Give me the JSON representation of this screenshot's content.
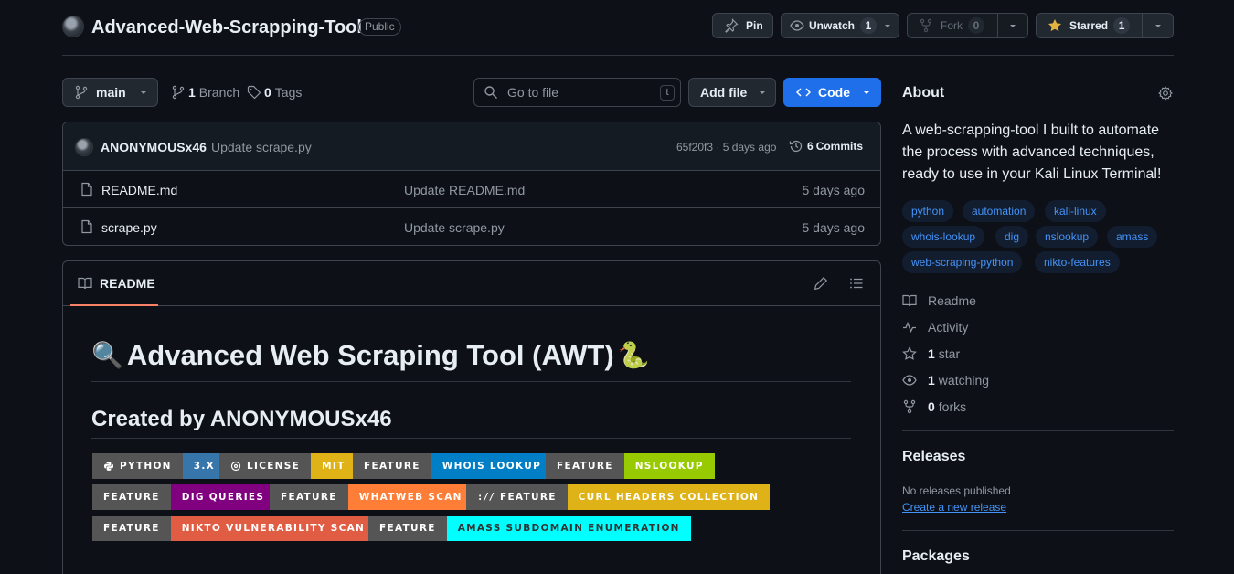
{
  "header": {
    "repo_name": "Advanced-Web-Scrapping-Tool",
    "visibility": "Public",
    "pin_label": "Pin",
    "unwatch_label": "Unwatch",
    "unwatch_count": "1",
    "fork_label": "Fork",
    "fork_count": "0",
    "starred_label": "Starred",
    "starred_count": "1"
  },
  "toolbar": {
    "branch": "main",
    "branches_count": "1",
    "branches_label": "Branch",
    "tags_count": "0",
    "tags_label": "Tags",
    "goto_placeholder": "Go to file",
    "goto_kbd": "t",
    "add_file": "Add file",
    "code": "Code"
  },
  "latest_commit": {
    "author": "ANONYMOUSx46",
    "message": "Update scrape.py",
    "hash_time": "65f20f3 · 5 days ago",
    "commits_count": "6",
    "commits_label": "Commits"
  },
  "files": [
    {
      "name": "README.md",
      "message": "Update README.md",
      "time": "5 days ago"
    },
    {
      "name": "scrape.py",
      "message": "Update scrape.py",
      "time": "5 days ago"
    }
  ],
  "readme": {
    "tab": "README",
    "h1_emoji_left": "🔍",
    "h1": "Advanced Web Scraping Tool (AWT)",
    "h1_emoji_right": "🐍",
    "h2": "Created by ANONYMOUSx46",
    "badges": [
      {
        "left": "PYTHON",
        "right": "3.X",
        "color": "#3776ab",
        "icon": "python-icon"
      },
      {
        "left": "LICENSE",
        "right": "MIT",
        "color": "#dfb317",
        "icon": "license-icon"
      },
      {
        "left": "FEATURE",
        "right": "WHOIS LOOKUP",
        "color": "#007ec6"
      },
      {
        "left": "FEATURE",
        "right": "NSLOOKUP",
        "color": "#97ca00"
      },
      {
        "left": "FEATURE",
        "right": "DIG QUERIES",
        "color": "#800080"
      },
      {
        "left": "FEATURE",
        "right": "WHATWEB SCAN",
        "color": "#fe7d37"
      },
      {
        "left": "FEATURE",
        "right": "CURL HEADERS COLLECTION",
        "color": "#dfb317",
        "icon": "curl-icon"
      },
      {
        "left": "FEATURE",
        "right": "NIKTO VULNERABILITY SCAN",
        "color": "#e05d44"
      },
      {
        "left": "FEATURE",
        "right": "AMASS SUBDOMAIN ENUMERATION",
        "color": "#00ffff",
        "right_text_color": "#333333"
      }
    ]
  },
  "about": {
    "title": "About",
    "description": "A web-scrapping-tool I built to automate the process with advanced techniques, ready to use in your Kali Linux Terminal!",
    "topics": [
      "python",
      "automation",
      "kali-linux",
      "whois-lookup",
      "dig",
      "nslookup",
      "amass",
      "web-scraping-python",
      "nikto-features"
    ],
    "readme": "Readme",
    "activity": "Activity",
    "stars_count": "1",
    "stars_label": "star",
    "watching_count": "1",
    "watching_label": "watching",
    "forks_count": "0",
    "forks_label": "forks"
  },
  "releases": {
    "title": "Releases",
    "none_text": "No releases published",
    "create_link": "Create a new release"
  },
  "packages": {
    "title": "Packages"
  }
}
